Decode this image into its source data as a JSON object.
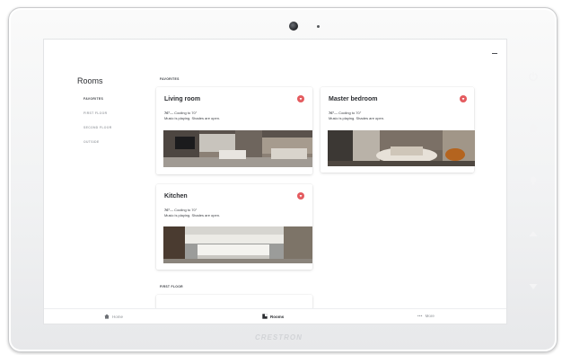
{
  "sidebar": {
    "title": "Rooms",
    "items": [
      {
        "label": "FAVORITES"
      },
      {
        "label": "FIRST FLOOR"
      },
      {
        "label": "SECOND FLOOR"
      },
      {
        "label": "OUTSIDE"
      }
    ]
  },
  "sections": {
    "favorites": "FAVORITES",
    "first_floor": "FIRST FLOOR"
  },
  "cards": [
    {
      "title": "Living room",
      "temp": "76°",
      "temp_detail": "— Cooling to 70°",
      "status": "Music is playing. Shades are open."
    },
    {
      "title": "Master bedroom",
      "temp": "76°",
      "temp_detail": "— Cooling to 70°",
      "status": "Music is playing. Shades are open."
    },
    {
      "title": "Kitchen",
      "temp": "76°",
      "temp_detail": "— Cooling to 70°",
      "status": "Music is playing. Shades are open."
    }
  ],
  "bottom_nav": [
    {
      "label": "Home",
      "icon": "home-icon"
    },
    {
      "label": "Rooms",
      "icon": "rooms-icon"
    },
    {
      "label": "More",
      "icon": "more-icon"
    }
  ],
  "device": {
    "brand": "CRESTRON",
    "buttons": [
      "power-icon",
      "home-icon",
      "light-bulb-icon",
      "volume-up-icon",
      "volume-down-icon"
    ]
  },
  "colors": {
    "accent": "#e45b5f",
    "text": "#2b2d31",
    "muted": "#a5a8ad",
    "device_buttons": "#f4f4f5"
  }
}
